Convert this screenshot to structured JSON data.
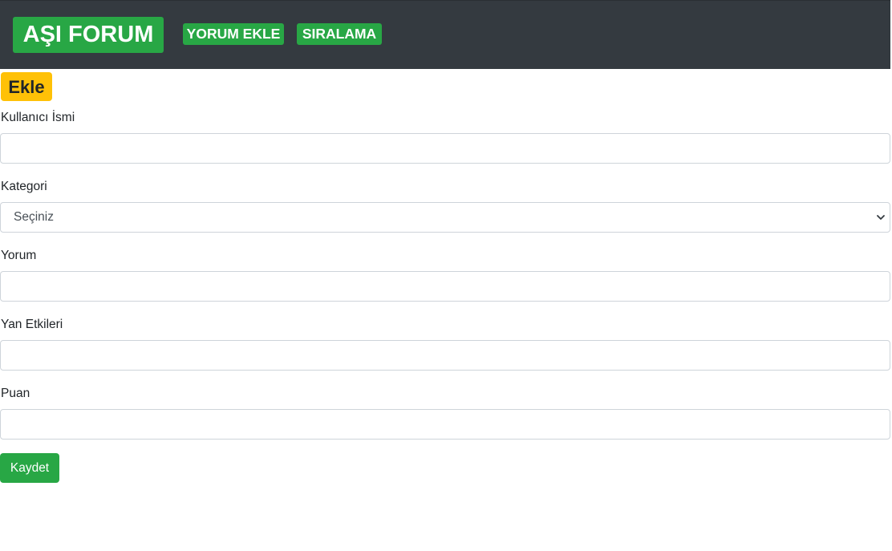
{
  "navbar": {
    "brand": "AŞI FORUM",
    "links": [
      {
        "label": "YORUM EKLE"
      },
      {
        "label": "SIRALAMA"
      }
    ]
  },
  "form": {
    "title": "Ekle",
    "fields": {
      "username": {
        "label": "Kullanıcı İsmi",
        "value": ""
      },
      "category": {
        "label": "Kategori",
        "selected": "Seçiniz"
      },
      "comment": {
        "label": "Yorum",
        "value": ""
      },
      "side_effects": {
        "label": "Yan Etkileri",
        "value": ""
      },
      "rating": {
        "label": "Puan",
        "value": ""
      }
    },
    "submit_label": "Kaydet"
  },
  "icons": {
    "select_arrow": "chevron-down-icon"
  },
  "colors": {
    "navbar_bg": "#343a40",
    "success": "#28a745",
    "warning": "#ffc107"
  }
}
